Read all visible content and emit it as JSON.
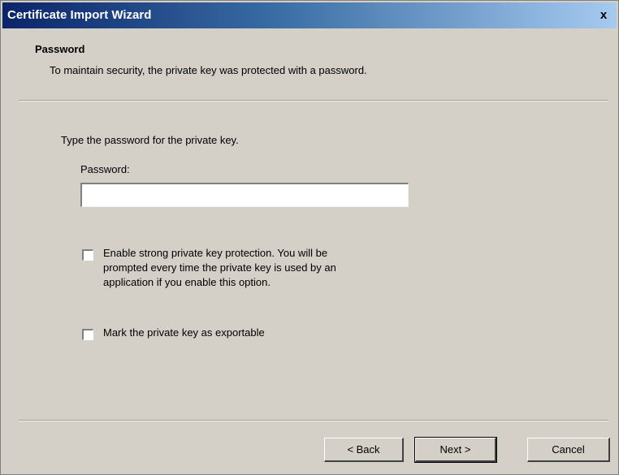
{
  "window": {
    "title": "Certificate Import Wizard",
    "close_label": "x"
  },
  "header": {
    "title": "Password",
    "subtitle": "To maintain security, the private key was protected with a password."
  },
  "body": {
    "instruction": "Type the password for the private key.",
    "password_label": "Password:",
    "password_value": "",
    "options": [
      {
        "label_line1": "Enable strong private key protection. You will be",
        "label_line2": "prompted every time the private key is used by an",
        "label_line3": "application if you enable this option.",
        "checked": false
      },
      {
        "label_line1": "Mark the private key as exportable",
        "checked": false
      }
    ]
  },
  "buttons": {
    "back": "< Back",
    "next": "Next >",
    "cancel": "Cancel"
  }
}
